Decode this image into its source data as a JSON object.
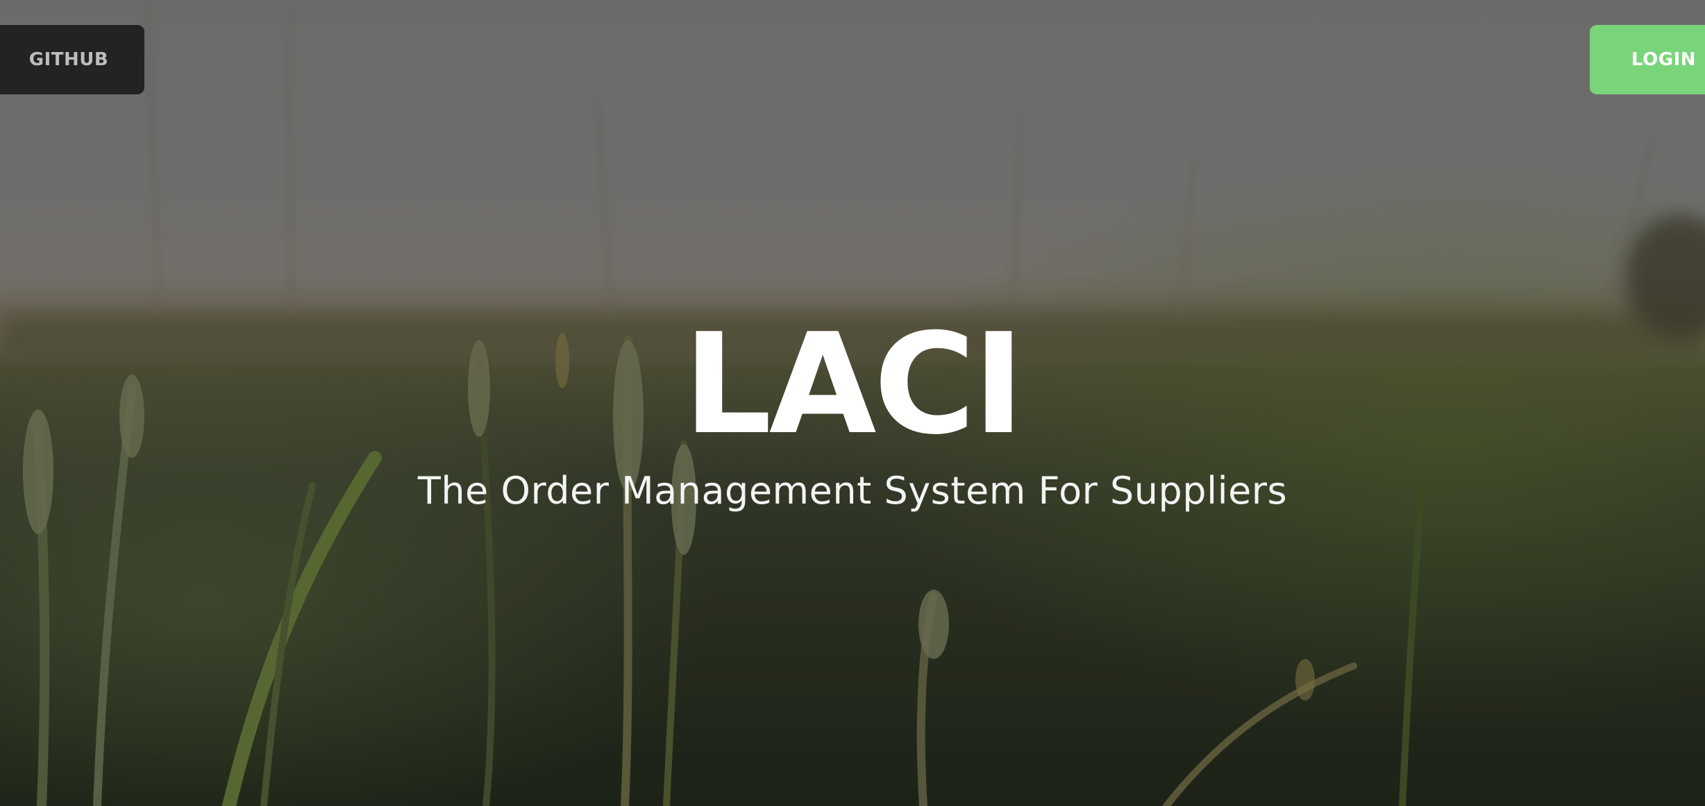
{
  "nav": {
    "github_label": "GITHUB",
    "login_label": "LOGIN"
  },
  "hero": {
    "title": "LACI",
    "subtitle": "The Order Management System For Suppliers",
    "background": "wheat-field-photo"
  },
  "colors": {
    "github_bg": "#232323",
    "login_bg": "#79d579",
    "title_text": "#ffffff"
  }
}
